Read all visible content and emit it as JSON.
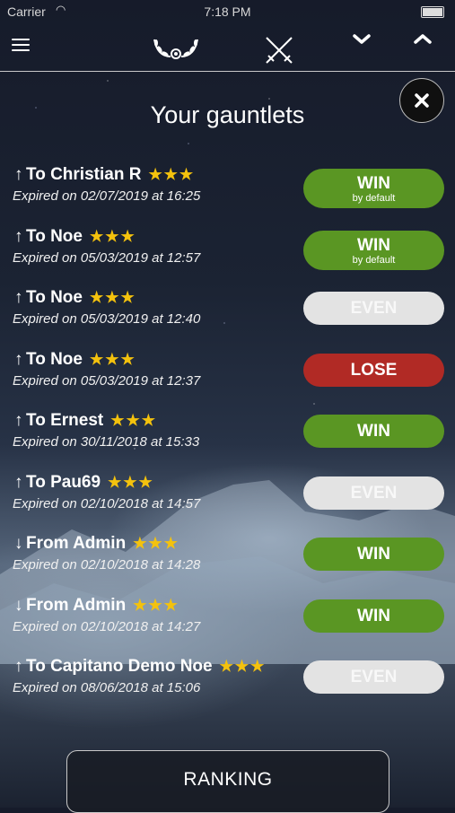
{
  "status": {
    "carrier": "Carrier",
    "time": "7:18 PM"
  },
  "header": {
    "title": "Your gauntlets"
  },
  "gauntlets": [
    {
      "direction": "up",
      "label": "To Christian R",
      "stars": "★★★",
      "date": "Expired on 02/07/2019 at 16:25",
      "result": "WIN",
      "result_type": "win",
      "result_sub": "by default"
    },
    {
      "direction": "up",
      "label": "To Noe",
      "stars": "★★★",
      "date": "Expired on 05/03/2019 at 12:57",
      "result": "WIN",
      "result_type": "win",
      "result_sub": "by default"
    },
    {
      "direction": "up",
      "label": "To Noe",
      "stars": "★★★",
      "date": "Expired on 05/03/2019 at 12:40",
      "result": "EVEN",
      "result_type": "even",
      "result_sub": ""
    },
    {
      "direction": "up",
      "label": "To Noe",
      "stars": "★★★",
      "date": "Expired on 05/03/2019 at 12:37",
      "result": "LOSE",
      "result_type": "lose",
      "result_sub": ""
    },
    {
      "direction": "up",
      "label": "To Ernest",
      "stars": "★★★",
      "date": "Expired on 30/11/2018 at 15:33",
      "result": "WIN",
      "result_type": "win",
      "result_sub": ""
    },
    {
      "direction": "up",
      "label": "To Pau69",
      "stars": "★★★",
      "date": "Expired on 02/10/2018 at 14:57",
      "result": "EVEN",
      "result_type": "even",
      "result_sub": ""
    },
    {
      "direction": "down",
      "label": "From Admin",
      "stars": "★★★",
      "date": "Expired on 02/10/2018 at 14:28",
      "result": "WIN",
      "result_type": "win",
      "result_sub": ""
    },
    {
      "direction": "down",
      "label": "From Admin",
      "stars": "★★★",
      "date": "Expired on 02/10/2018 at 14:27",
      "result": "WIN",
      "result_type": "win",
      "result_sub": ""
    },
    {
      "direction": "up",
      "label": "To Capitano Demo Noe",
      "stars": "★★★",
      "date": "Expired on 08/06/2018 at 15:06",
      "result": "EVEN",
      "result_type": "even",
      "result_sub": ""
    }
  ],
  "footer": {
    "ranking_label": "RANKING"
  },
  "icons": {
    "menu": "menu-icon",
    "laurel": "laurel-icon",
    "swords": "swords-icon",
    "down": "chevron-down-icon",
    "up": "chevron-up-icon",
    "close": "close-icon"
  },
  "colors": {
    "win": "#5a9623",
    "lose": "#b12a25",
    "even": "#e3e3e3",
    "stars": "#f4c20d"
  }
}
